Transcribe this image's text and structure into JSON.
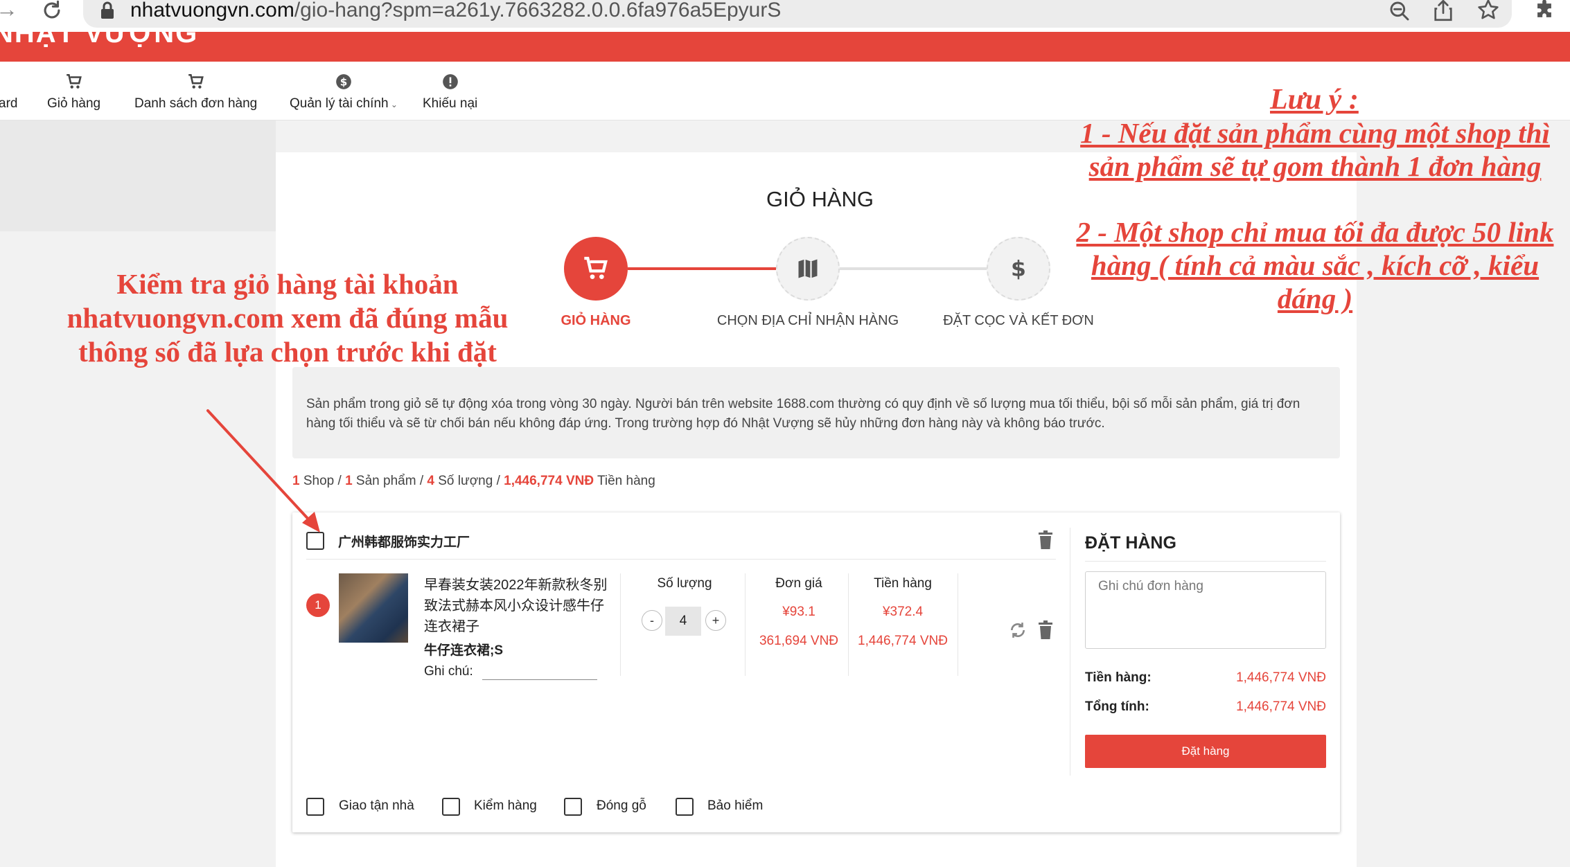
{
  "browser": {
    "url_domain": "nhatvuongvn.com",
    "url_path": "/gio-hang?spm=a261y.7663282.0.0.6fa976a5EpyurS"
  },
  "site": {
    "logo_text": "NHẬT VƯỢNG"
  },
  "nav": {
    "items": [
      {
        "label": "ard"
      },
      {
        "label": "Giỏ hàng"
      },
      {
        "label": "Danh sách đơn hàng"
      },
      {
        "label": "Quản lý tài chính"
      },
      {
        "label": "Khiếu nại"
      }
    ]
  },
  "page": {
    "title": "GIỎ HÀNG"
  },
  "steps": [
    {
      "label": "GIỎ HÀNG"
    },
    {
      "label": "CHỌN ĐỊA CHỈ NHẬN HÀNG"
    },
    {
      "label": "ĐẶT CỌC VÀ KẾT ĐƠN"
    }
  ],
  "notice": {
    "line1": "Sản phẩm trong giỏ sẽ tự động xóa trong vòng 30 ngày. Người bán trên website 1688.com thường có quy định về số lượng mua tối thiểu, bội số mỗi sản phẩm, giá trị đơn",
    "line2": "hàng tối thiểu và sẽ từ chối bán nếu không đáp ứng. Trong trường hợp đó Nhật Vượng sẽ hủy những đơn hàng này và không báo trước."
  },
  "summary": {
    "shop_count": "1",
    "shop_label": " Shop / ",
    "product_count": "1",
    "product_label": " Sản phẩm / ",
    "qty_count": "4",
    "qty_label": " Số lượng / ",
    "total": "1,446,774 VNĐ",
    "total_label": " Tiền hàng"
  },
  "shop": {
    "name": "广州韩都服饰实力工厂"
  },
  "item": {
    "index": "1",
    "name": "早春装女装2022年新款秋冬别致法式赫本风小众设计感牛仔连衣裙子",
    "variant": "牛仔连衣裙;S",
    "note_label": "Ghi chú:",
    "qty_header": "Số lượng",
    "qty_minus": "-",
    "qty_plus": "+",
    "qty_value": "4",
    "unit_header": "Đơn giá",
    "unit_price_cny": "¥93.1",
    "unit_price_vnd": "361,694 VNĐ",
    "amount_header": "Tiền hàng",
    "amount_cny": "¥372.4",
    "amount_vnd": "1,446,774 VNĐ"
  },
  "order_panel": {
    "title": "ĐẶT HÀNG",
    "note_placeholder": "Ghi chú đơn hàng",
    "subtotal_label": "Tiền hàng:",
    "subtotal_value": "1,446,774 VNĐ",
    "total_label": "Tổng tính:",
    "total_value": "1,446,774 VNĐ",
    "button_label": "Đặt hàng"
  },
  "options": [
    {
      "label": "Giao tận nhà"
    },
    {
      "label": "Kiểm hàng"
    },
    {
      "label": "Đóng gỗ"
    },
    {
      "label": "Bảo hiểm"
    }
  ],
  "annotations": {
    "right_heading": "Lưu ý :",
    "right_note1_line1": "1 - Nếu đặt sản phẩm cùng một shop thì",
    "right_note1_line2": "sản phẩm sẽ tự gom thành 1 đơn hàng",
    "right_note2_line1": "2 - Một shop chỉ mua tối đa được 50 link",
    "right_note2_line2": "hàng ( tính cả màu sắc , kích cỡ , kiểu",
    "right_note2_line3": "dáng )",
    "left_line1": "Kiểm tra giỏ hàng tài khoản",
    "left_line2": "nhatvuongvn.com xem đã đúng mẫu",
    "left_line3": "thông số đã lựa chọn trước khi đặt"
  },
  "colors": {
    "accent": "#e5453b",
    "muted_bg": "#f0f0f0"
  }
}
